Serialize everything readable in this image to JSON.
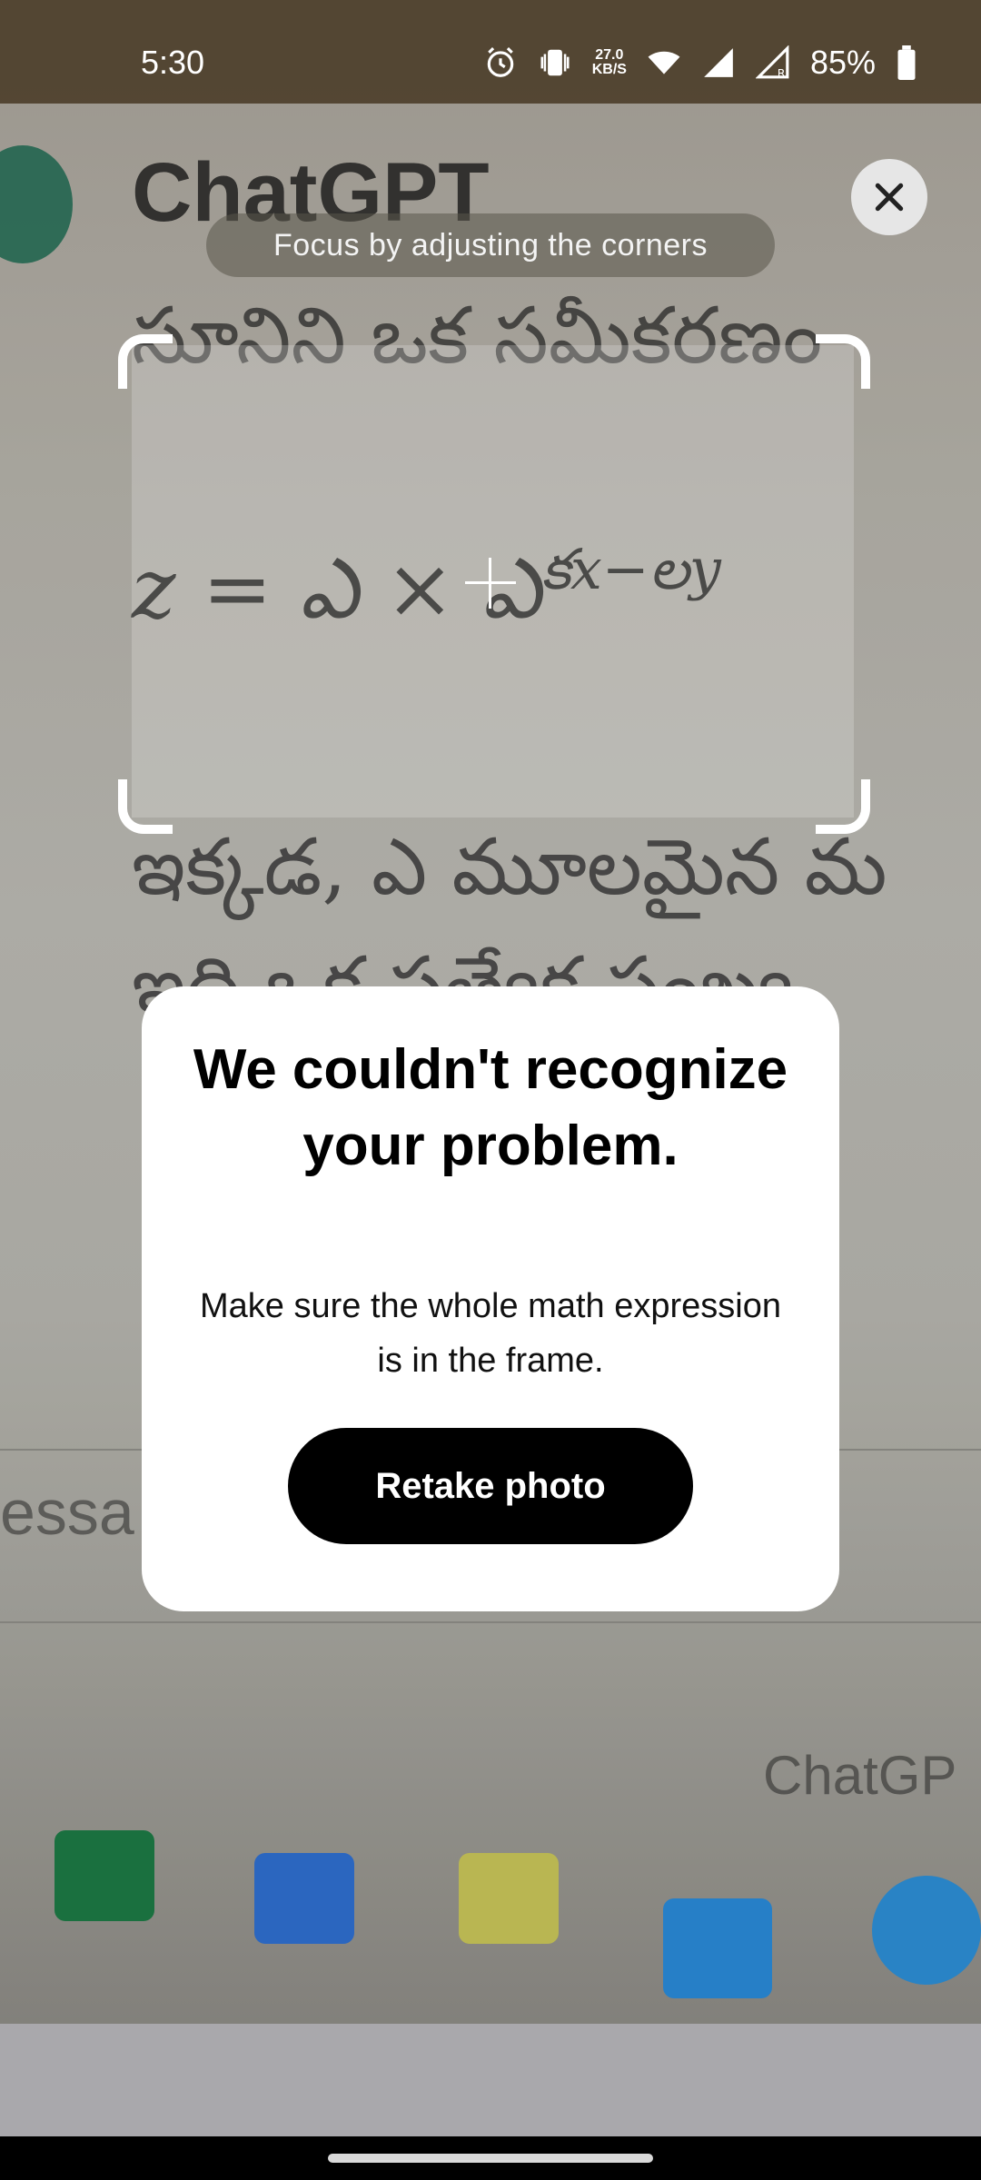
{
  "status_bar": {
    "time": "5:30",
    "network_speed_value": "27.0",
    "network_speed_unit": "KB/S",
    "battery_percent": "85%",
    "icons": [
      "alarm-icon",
      "vibrate-icon",
      "wifi-icon",
      "signal-icon",
      "signal-roaming-icon",
      "battery-icon"
    ]
  },
  "camera": {
    "brand_text": "ChatGPT",
    "line_top": "సూనిని ఒక సమీకరణం",
    "equation": "z = ఎ × ఎ",
    "equation_exp": "కx−లy",
    "line_below_1": "ఇక్కడ, ఎ మూలమైన మ",
    "line_below_2": "ఇది ఒక ప్రత్యేక సంఖ్య",
    "partial_input": "essa",
    "corner_text": "ChatGP"
  },
  "hint": "Focus by adjusting the corners",
  "dialog": {
    "title": "We couldn't recognize your problem.",
    "message": "Make sure the whole math expression is in the frame.",
    "button_label": "Retake photo"
  },
  "colors": {
    "dialog_bg": "#ffffff",
    "button_bg": "#000000",
    "button_text": "#ffffff",
    "status_bar_bg": "#463723"
  }
}
